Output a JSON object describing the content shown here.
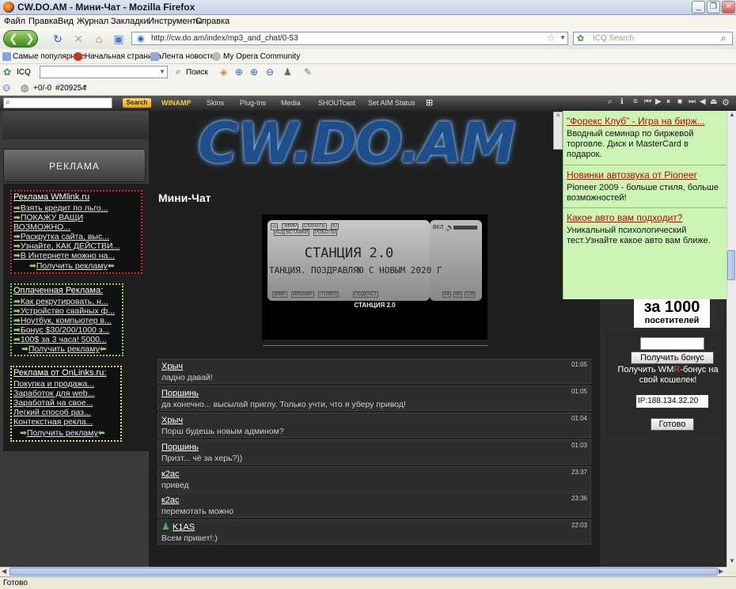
{
  "window": {
    "title": "CW.DO.AM - Мини-Чат - Mozilla Firefox"
  },
  "menu": [
    "Файл",
    "Правка",
    "Вид",
    "Журнал",
    "Закладки",
    "Инструменты",
    "Справка"
  ],
  "nav": {
    "url": "http://cw.do.am/index/mp3_and_chat/0-53",
    "search_placeholder": "ICQ Search"
  },
  "bookmarks": [
    "Самые популярные",
    "Начальная страница",
    "Лента новостей",
    "My Opera Community"
  ],
  "icqbar": {
    "label": "ICQ",
    "search_label": "Поиск"
  },
  "miscbar": {
    "counter": "+0/-0",
    "ticket": "#209254"
  },
  "winamp": {
    "search_button": "Search",
    "brand": "WINAMP",
    "menus": [
      "Skins",
      "Plug-Ins",
      "Media",
      "SHOUTcast",
      "Set AIM Status"
    ]
  },
  "sidebar": {
    "ad_header": "РЕКЛАМА",
    "red_box": {
      "title": "Реклама WMlink.ru",
      "links": [
        "Взять кредит по льго...",
        "ПОКАЖУ ВАЩИ",
        "ВОЗМОЖНО...",
        "Раскрутка сайта, выс...",
        "Узнайте, КАК ДЕЙСТВИ...",
        "В Интернете можно на..."
      ],
      "get": "Получить рекламу"
    },
    "green_box": {
      "title": "Оплаченная Реклама:",
      "links": [
        "Как рекрутировать, н...",
        "Устройство свайных ф...",
        "Ноутбук, компьютер в...",
        "Бонус $30/200/1000 з...",
        "100$ за 3 часа! 5000..."
      ],
      "get": "Получить рекламу"
    },
    "yellow_box": {
      "title": "Реклама от OnLinks.ru:",
      "links": [
        "Покупка и продажа...",
        "Заработок для web...",
        "Заработай на свое...",
        "Легкий способ раз...",
        "Контекстная рекла..."
      ],
      "get": "Получить рекламу"
    }
  },
  "main": {
    "logo": "CW.DO.AM",
    "title": "Мини-Чат",
    "player": {
      "station": "СТАНЦИЯ 2.0",
      "marquee": "ТАНЦИЯ. ПОЗДРАВЛЯЮ С НОВЫМ 2020 Г",
      "label": "СТАНЦИЯ 2.0",
      "vol": "ВКЛ",
      "tabs": [
        "ЭФИР",
        "СКАЧАТЬ",
        "Ю",
        "КОД ВСТАВКИ",
        "РОБОТЫ"
      ],
      "bottom": [
        "WMP",
        "WINAMP",
        "ITUNES",
        "ПОДКАСТ"
      ],
      "bitrates": [
        "64",
        "96",
        "128"
      ]
    },
    "messages": [
      {
        "name": "Хрыч",
        "time": "01:05",
        "text": "ладно давай!"
      },
      {
        "name": "Поршинь",
        "time": "01:05",
        "text": "да конечно... высылай приглу. Только учти, что я уберу привод!"
      },
      {
        "name": "Хрыч",
        "time": "01:04",
        "text": "Порш будешь новым админом?"
      },
      {
        "name": "Поршинь",
        "time": "01:03",
        "text": "Призт... чё за херь?))"
      },
      {
        "name": "к2ас",
        "time": "23:37",
        "text": "привед"
      },
      {
        "name": "к2ас",
        "time": "23:36",
        "text": "перемотать можно"
      },
      {
        "name": "K1AS",
        "time": "22:03",
        "text": "Всем привет!:)"
      }
    ]
  },
  "right": {
    "counter_top": "за 1000",
    "counter_bottom": "посетителей",
    "bonus_button": "Получить бонус",
    "bonus_text_1": "Получить WM",
    "bonus_text_r": "R",
    "bonus_text_2": "-бонус на свой кошелек!",
    "ip": "IP:188.134.32.20",
    "done_button": "Готово"
  },
  "green_ad": [
    {
      "title": "\"Форекс Клуб\" - Игра на бирж...",
      "desc": "Вводный семинар по биржевой торговле. Диск и MasterCard в подарок."
    },
    {
      "title": "Новинки автозвука от Pioneer",
      "desc": "Pioneer 2009 - больше стиля, больше возможностей!"
    },
    {
      "title": "Какое авто вам подходит?",
      "desc": "Уникальный психологический тест.Узнайте какое авто вам ближе."
    }
  ],
  "status": "Готово"
}
